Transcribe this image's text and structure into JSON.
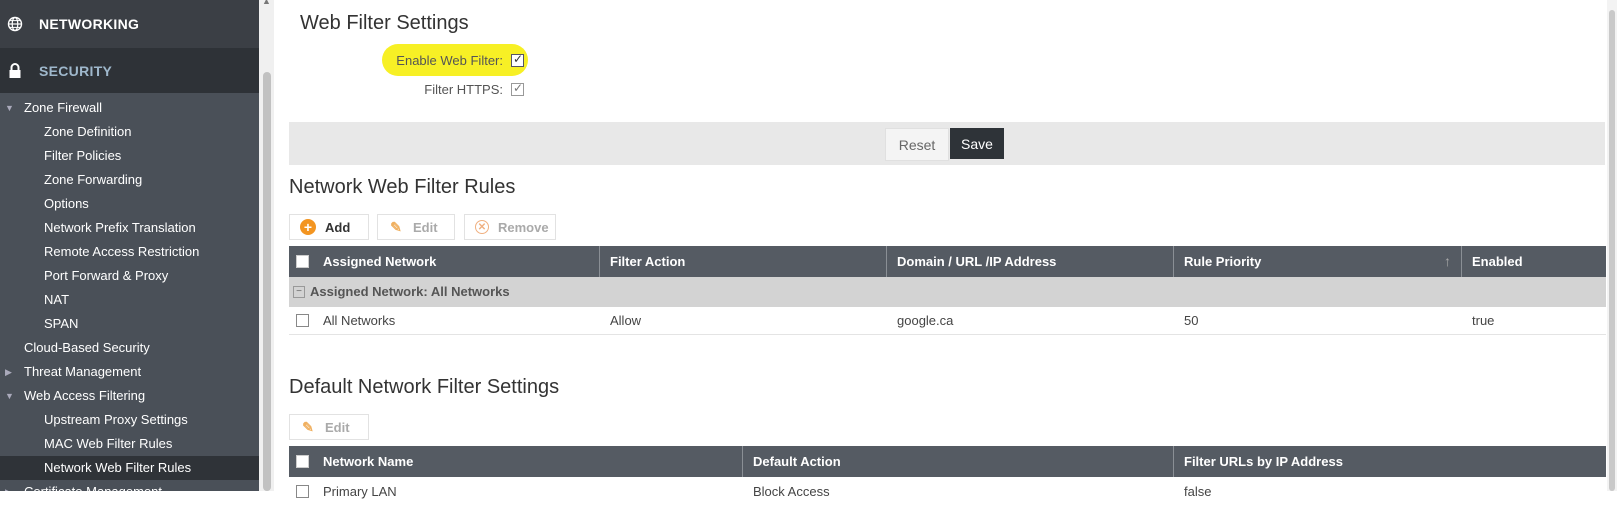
{
  "sidebar": {
    "networking": "NETWORKING",
    "security": "SECURITY",
    "items": [
      {
        "label": "Zone Firewall",
        "level": 1,
        "caret": "down"
      },
      {
        "label": "Zone Definition",
        "level": 2
      },
      {
        "label": "Filter Policies",
        "level": 2
      },
      {
        "label": "Zone Forwarding",
        "level": 2
      },
      {
        "label": "Options",
        "level": 2
      },
      {
        "label": "Network Prefix Translation",
        "level": 2
      },
      {
        "label": "Remote Access Restriction",
        "level": 2
      },
      {
        "label": "Port Forward & Proxy",
        "level": 2
      },
      {
        "label": "NAT",
        "level": 2
      },
      {
        "label": "SPAN",
        "level": 2
      },
      {
        "label": "Cloud-Based Security",
        "level": 1
      },
      {
        "label": "Threat Management",
        "level": 1,
        "caret": "right"
      },
      {
        "label": "Web Access Filtering",
        "level": 1,
        "caret": "down"
      },
      {
        "label": "Upstream Proxy Settings",
        "level": 2
      },
      {
        "label": "MAC Web Filter Rules",
        "level": 2
      },
      {
        "label": "Network Web Filter Rules",
        "level": 2,
        "active": true
      },
      {
        "label": "Certificate Management",
        "level": 1,
        "caret": "right"
      }
    ]
  },
  "settings": {
    "title": "Web Filter Settings",
    "enable_label": "Enable Web Filter:",
    "enable_checked": true,
    "https_label": "Filter HTTPS:",
    "https_checked": true,
    "reset_label": "Reset",
    "save_label": "Save"
  },
  "rules": {
    "title": "Network Web Filter Rules",
    "add_label": "Add",
    "edit_label": "Edit",
    "remove_label": "Remove",
    "columns": [
      "Assigned Network",
      "Filter Action",
      "Domain / URL /IP Address",
      "Rule Priority",
      "Enabled"
    ],
    "group_label": "Assigned Network: All Networks",
    "rows": [
      {
        "network": "All Networks",
        "action": "Allow",
        "domain": "google.ca",
        "priority": "50",
        "enabled": "true"
      }
    ]
  },
  "defaults": {
    "title": "Default Network Filter Settings",
    "edit_label": "Edit",
    "columns": [
      "Network Name",
      "Default Action",
      "Filter URLs by IP Address"
    ],
    "rows": [
      {
        "name": "Primary LAN",
        "action": "Block Access",
        "filter_ip": "false"
      }
    ]
  },
  "colors": {
    "sidebar_bg": "#4a5058",
    "header_bg": "#555b63",
    "save_bg": "#2e3338",
    "highlight": "#f7f025",
    "add_icon": "#f39521"
  }
}
